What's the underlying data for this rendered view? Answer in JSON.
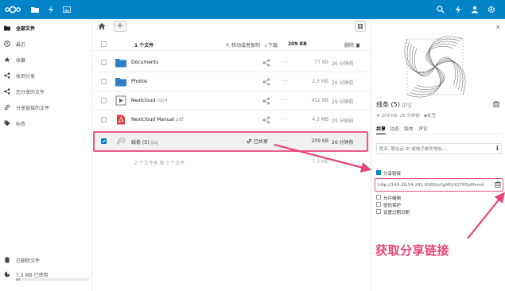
{
  "header": {
    "logo_icon": "nextcloud-logo",
    "apps": [
      "files-icon",
      "activity-icon",
      "gallery-icon"
    ],
    "right_icons": [
      "search-icon",
      "notifications-icon",
      "contacts-icon",
      "settings-icon"
    ],
    "accent": "#0082c9"
  },
  "sidebar": {
    "items": [
      {
        "label": "全部文件",
        "icon": "folder-icon"
      },
      {
        "label": "最近",
        "icon": "clock-icon"
      },
      {
        "label": "收藏",
        "icon": "star-icon"
      },
      {
        "label": "收到分享",
        "icon": "share-icon"
      },
      {
        "label": "您分享的文件",
        "icon": "share-icon"
      },
      {
        "label": "分享链接的文件",
        "icon": "link-icon"
      },
      {
        "label": "标签",
        "icon": "tag-icon"
      }
    ],
    "deleted_label": "已删除文件",
    "quota_label": "7.3 MB 已使用",
    "quota_fraction": 0.05
  },
  "toolbar": {
    "new_label": "+"
  },
  "table": {
    "header": {
      "count": "1 个文件",
      "move_copy": "移动或者复制",
      "download": "下载",
      "total_size": "209 KB",
      "delete": "删除"
    },
    "rows": [
      {
        "name": "Documents",
        "ext": "",
        "type": "folder",
        "size": "77 KB",
        "modified": "26 分钟前",
        "shared": ""
      },
      {
        "name": "Photos",
        "ext": "",
        "type": "folder",
        "size": "2.3 MB",
        "modified": "26 分钟前",
        "shared": ""
      },
      {
        "name": "Nextcloud",
        "ext": ".mp4",
        "type": "video",
        "size": "452 KB",
        "modified": "29 分钟前",
        "shared": ""
      },
      {
        "name": "Nextcloud Manual",
        "ext": ".pdf",
        "type": "pdf",
        "size": "4.3 MB",
        "modified": "29 分钟前",
        "shared": ""
      },
      {
        "name": "线条 (5)",
        "ext": ".jpg",
        "type": "image",
        "size": "209 KB",
        "modified": "26 分钟前",
        "shared": "已共享"
      }
    ],
    "summary_left": "2 个文件夹 和 3 个文件",
    "summary_size": "7.3 MB"
  },
  "panel": {
    "title": "线条 (5)",
    "title_ext": ".jpg",
    "meta": "209 KB, 26 分钟前",
    "tags_label": "标签",
    "tabs": [
      "共享",
      "动态",
      "版本",
      "评论"
    ],
    "share_placeholder": "姓名, 联合云 ID 或电子邮件地址...",
    "share_link_label": "分享链接",
    "link_url": "http://149.28.54.241:8080/s/tgMGHQ7R5pMsmd",
    "allow_edit": "允许编辑",
    "password_protect": "密码保护",
    "expiry": "设置过期日期"
  },
  "annotation": {
    "text": "获取分享链接",
    "color": "#e8457a"
  }
}
